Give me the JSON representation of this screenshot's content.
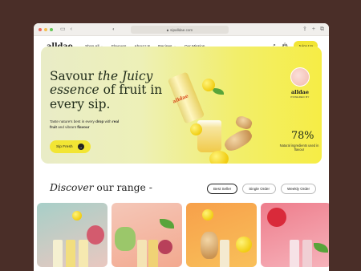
{
  "browser": {
    "url": "sipalldae.com",
    "back_icon": "chevron-left-icon",
    "sidebar_icon": "sidebar-icon",
    "shield_icon": "shield-icon",
    "right_icons": [
      "share-icon",
      "plus-icon",
      "tabs-icon"
    ]
  },
  "nav": {
    "logo": "alldae",
    "menu": [
      "Shop All",
      "Flavours",
      "About Us",
      "Recipes",
      "Our Mission"
    ],
    "menu_dropdown": [
      "Shop All",
      "Recipes"
    ],
    "cta": "Juice Up"
  },
  "hero": {
    "title_line1": "Savour",
    "title_italic1": "the Juicy",
    "title_italic2": "essence",
    "title_line2_rest": "of fruit in",
    "title_line3": "every sip.",
    "sub_before": "Taste nature's best in every",
    "sub_bold1": "drop",
    "sub_mid": "with",
    "sub_bold2": "real fruit",
    "sub_mid2": "and vibrant",
    "sub_bold3": "flavour",
    "button": "Sip Fresh",
    "can_label": "alldae",
    "badge_logo": "alldae",
    "badge_sub": "POWERED BY",
    "stat_value": "78%",
    "stat_caption": "Natural ingredients used in flavour"
  },
  "range": {
    "title_italic": "Discover",
    "title_rest": "our range -",
    "filters": [
      "Best Seller",
      "Single Order",
      "Weekly Order"
    ],
    "active_filter": "Best Seller"
  },
  "colors": {
    "accent_yellow": "#f2e534",
    "page_bg": "#4a2e28",
    "brand_dot": "#e85a2b"
  },
  "cards": [
    {
      "bg": "linear-gradient(160deg,#a7cfc8,#e9c8c0)"
    },
    {
      "bg": "linear-gradient(160deg,#f4c7b8,#f3a98f)"
    },
    {
      "bg": "linear-gradient(160deg,#f7a04a,#f9c05a)"
    },
    {
      "bg": "linear-gradient(160deg,#ee7d8c,#f6b3bb)"
    }
  ]
}
